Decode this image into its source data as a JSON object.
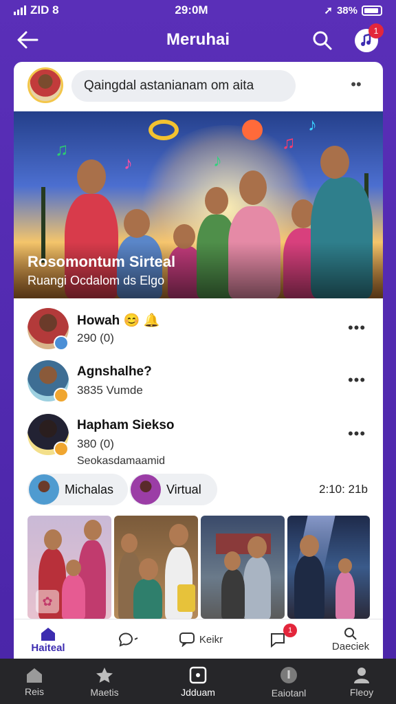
{
  "status_bar": {
    "left_text": "ZID 8",
    "time": "29:0M",
    "battery": "38%"
  },
  "app_bar": {
    "title": "Meruhai",
    "notification_count": "1"
  },
  "composer": {
    "placeholder": "Qaingdal astanianam om aita"
  },
  "hero": {
    "title": "Rosomontum Sirteal",
    "subtitle": "Ruangi Ocdalom ds Elgo"
  },
  "feed": [
    {
      "name": "Howah 😊 🔔",
      "meta": "290 (0)",
      "meta2": "",
      "avatar_color": "#7b3a3a",
      "badge_color": "#4b8fd6"
    },
    {
      "name": "Agnshalhe?",
      "meta": "3835 Vumde",
      "meta2": "",
      "avatar_color": "#3e6e94",
      "badge_color": "#f0a630"
    },
    {
      "name": "Hapham Siekso",
      "meta": "380 (0)",
      "meta2": "Seokasdamaamid",
      "avatar_color": "#222233",
      "badge_color": "#f0a630"
    }
  ],
  "chips": [
    {
      "label": "Michalas",
      "avatar_color": "#4f9bd0"
    },
    {
      "label": "Virtual",
      "avatar_color": "#9b3da6"
    }
  ],
  "chip_time": "2:10: 21b",
  "inner_tabs": [
    {
      "label": "Haiteal",
      "active": true
    },
    {
      "label": "",
      "active": false
    },
    {
      "label": "Keikr",
      "active": false
    },
    {
      "label": "",
      "active": false,
      "badge": "1"
    },
    {
      "label": "Daeciek",
      "active": false
    }
  ],
  "bottom_nav": [
    {
      "label": "Reis",
      "active": false
    },
    {
      "label": "Maetis",
      "active": false
    },
    {
      "label": "Jdduam",
      "active": true
    },
    {
      "label": "Eaiotanl",
      "active": false
    },
    {
      "label": "Fleoy",
      "active": false
    }
  ],
  "colors": {
    "brand_purple": "#5a2fb8",
    "accent_red": "#e3263b",
    "nav_dark": "#262629"
  }
}
